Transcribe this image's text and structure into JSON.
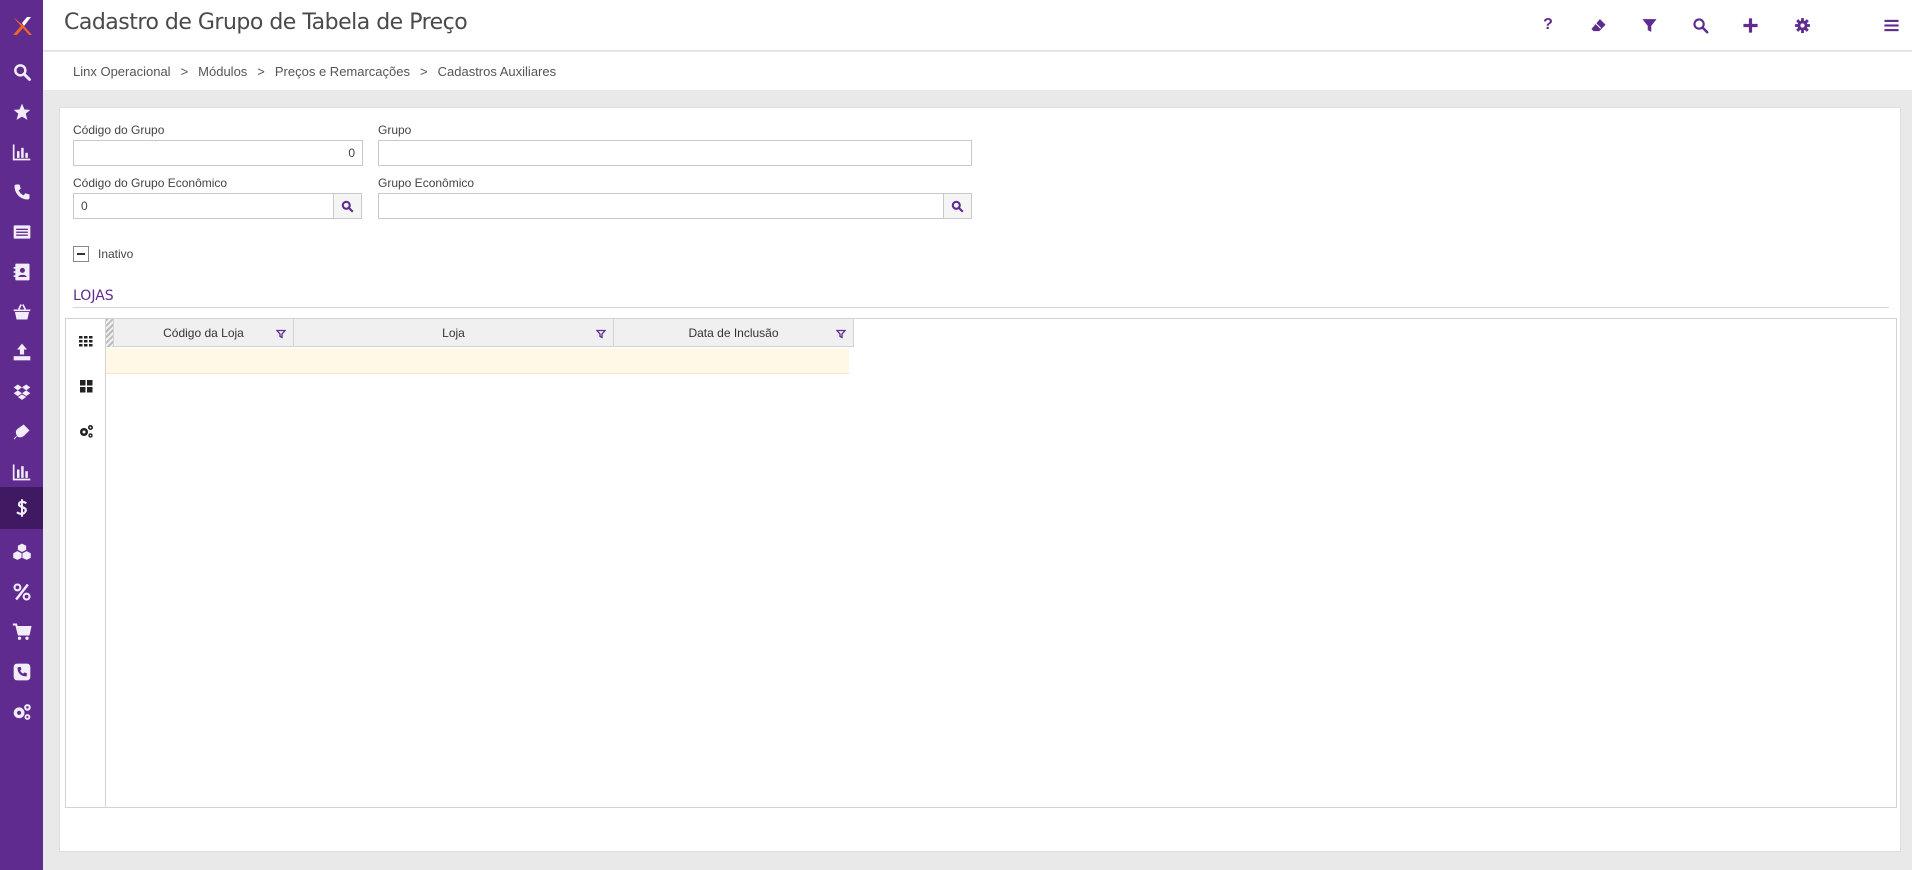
{
  "app": {
    "title": "Cadastro de Grupo de Tabela de Preço",
    "accent_color": "#5f2b8f",
    "logo_colors": [
      "#f26522",
      "#ffffff"
    ]
  },
  "sidebar": {
    "items": [
      {
        "icon": "search-icon"
      },
      {
        "icon": "star-icon"
      },
      {
        "icon": "bar-chart-icon"
      },
      {
        "icon": "phone-icon"
      },
      {
        "icon": "list-icon"
      },
      {
        "icon": "contact-card-icon"
      },
      {
        "icon": "basket-icon"
      },
      {
        "icon": "upload-icon"
      },
      {
        "icon": "dropbox-icon"
      },
      {
        "icon": "plug-icon"
      },
      {
        "icon": "bar-chart-icon"
      },
      {
        "icon": "dollar-icon",
        "active": true
      },
      {
        "icon": "cubes-icon"
      },
      {
        "icon": "percent-icon"
      },
      {
        "icon": "cart-icon"
      },
      {
        "icon": "phone-square-icon"
      },
      {
        "icon": "gears-icon"
      }
    ]
  },
  "header": {
    "actions": [
      {
        "icon": "help-icon",
        "label": "?"
      },
      {
        "icon": "eraser-icon"
      },
      {
        "icon": "filter-icon"
      },
      {
        "icon": "search-icon"
      },
      {
        "icon": "plus-icon"
      },
      {
        "icon": "gear-icon"
      },
      {
        "icon": "menu-icon"
      }
    ]
  },
  "breadcrumb": {
    "items": [
      "Linx Operacional",
      "Módulos",
      "Preços e Remarcações",
      "Cadastros Auxiliares"
    ],
    "separator": ">"
  },
  "form": {
    "codigo_grupo": {
      "label": "Código do Grupo",
      "value": "0"
    },
    "grupo": {
      "label": "Grupo",
      "value": ""
    },
    "codigo_grupo_economico": {
      "label": "Código do Grupo Econômico",
      "value": "0"
    },
    "grupo_economico": {
      "label": "Grupo Econômico",
      "value": ""
    },
    "inativo": {
      "label": "Inativo",
      "state": "indeterminate"
    }
  },
  "lojas": {
    "title": "LOJAS",
    "tools": [
      {
        "icon": "grid-view-icon"
      },
      {
        "icon": "tiles-view-icon"
      },
      {
        "icon": "grid-settings-icon"
      }
    ],
    "columns": [
      {
        "label": "Código da Loja",
        "filterable": true
      },
      {
        "label": "Loja",
        "filterable": true
      },
      {
        "label": "Data de Inclusão",
        "filterable": true
      }
    ],
    "rows": [],
    "new_row_color": "#fff8e6"
  }
}
